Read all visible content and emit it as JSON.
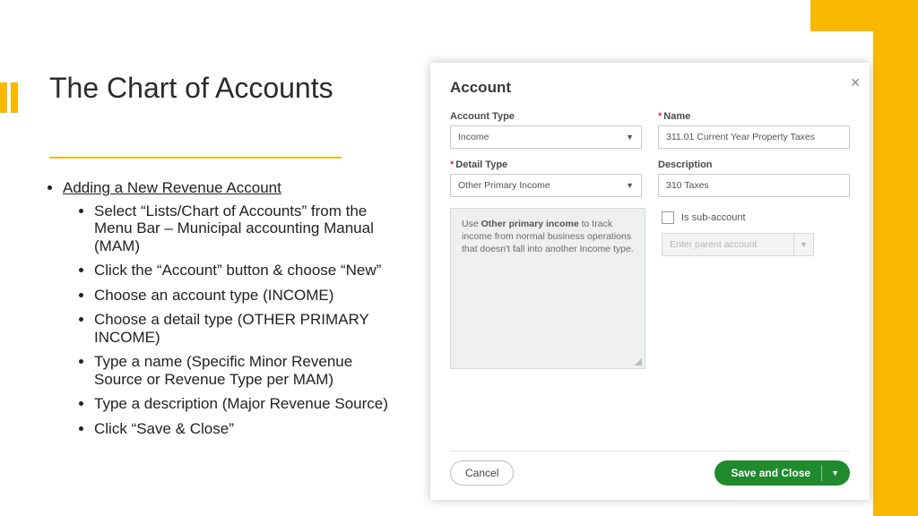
{
  "slide": {
    "title": "The Chart of Accounts",
    "subhead": "Adding a New Revenue Account",
    "bullets": [
      "Select “Lists/Chart of Accounts” from the Menu Bar – Municipal accounting Manual (MAM)",
      "Click the “Account” button & choose “New”",
      "Choose an account type (INCOME)",
      "Choose a detail type (OTHER PRIMARY INCOME)",
      "Type a name (Specific Minor Revenue Source or Revenue Type per MAM)",
      "Type a description (Major Revenue Source)",
      "Click “Save & Close”"
    ]
  },
  "dialog": {
    "title": "Account",
    "labels": {
      "account_type": "Account Type",
      "name": "Name",
      "detail_type": "Detail Type",
      "description": "Description",
      "sub_account": "Is sub-account",
      "parent_placeholder": "Enter parent account"
    },
    "values": {
      "account_type": "Income",
      "detail_type": "Other Primary Income",
      "name": "311.01 Current Year Property Taxes",
      "description": "310 Taxes"
    },
    "hint": {
      "pre": "Use ",
      "bold": "Other primary income",
      "post": " to track income from normal business operations that doesn't fall into another Income type."
    },
    "buttons": {
      "cancel": "Cancel",
      "save": "Save and Close"
    }
  }
}
